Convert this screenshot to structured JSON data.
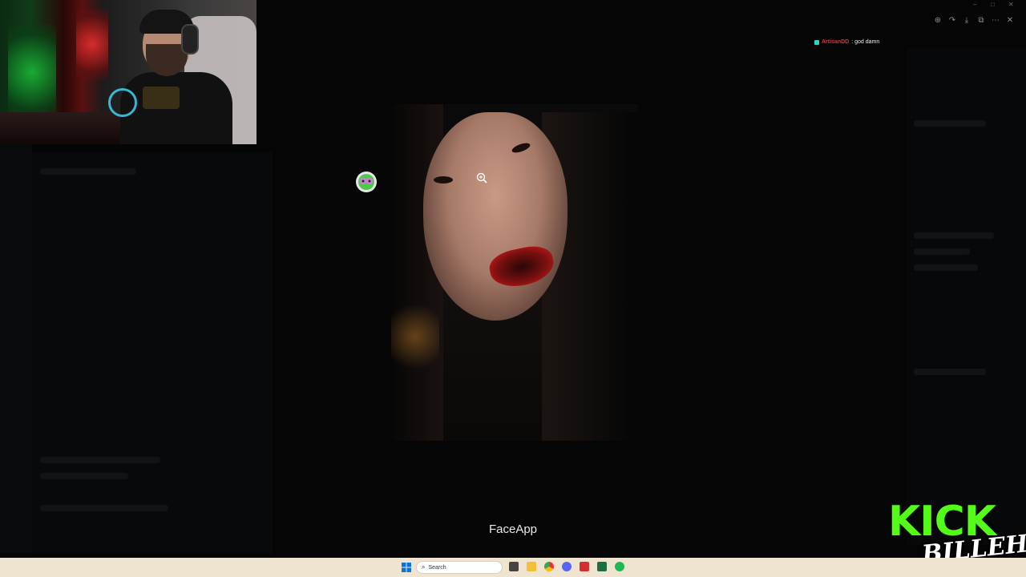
{
  "chat": {
    "username": "ArtisanDD",
    "message": ": god damn"
  },
  "viewer": {
    "tools": [
      "zoom-in-icon",
      "redo-icon",
      "download-icon",
      "external-link-icon",
      "more-icon",
      "close-icon"
    ]
  },
  "caption": "FaceApp",
  "brand": {
    "kick": "KICK",
    "channel": "BILLEH",
    "kick_color": "#53fc18"
  },
  "taskbar": {
    "search_placeholder": "Search",
    "apps": [
      "task-view-icon",
      "file-explorer-icon",
      "chrome-icon",
      "discord-icon",
      "red-app-icon",
      "excel-icon",
      "spotify-icon"
    ]
  },
  "colors": {
    "chat_user": "#e0303a",
    "chat_badge": "#2dd4bf",
    "taskbar_bg": "#efe4d0"
  }
}
